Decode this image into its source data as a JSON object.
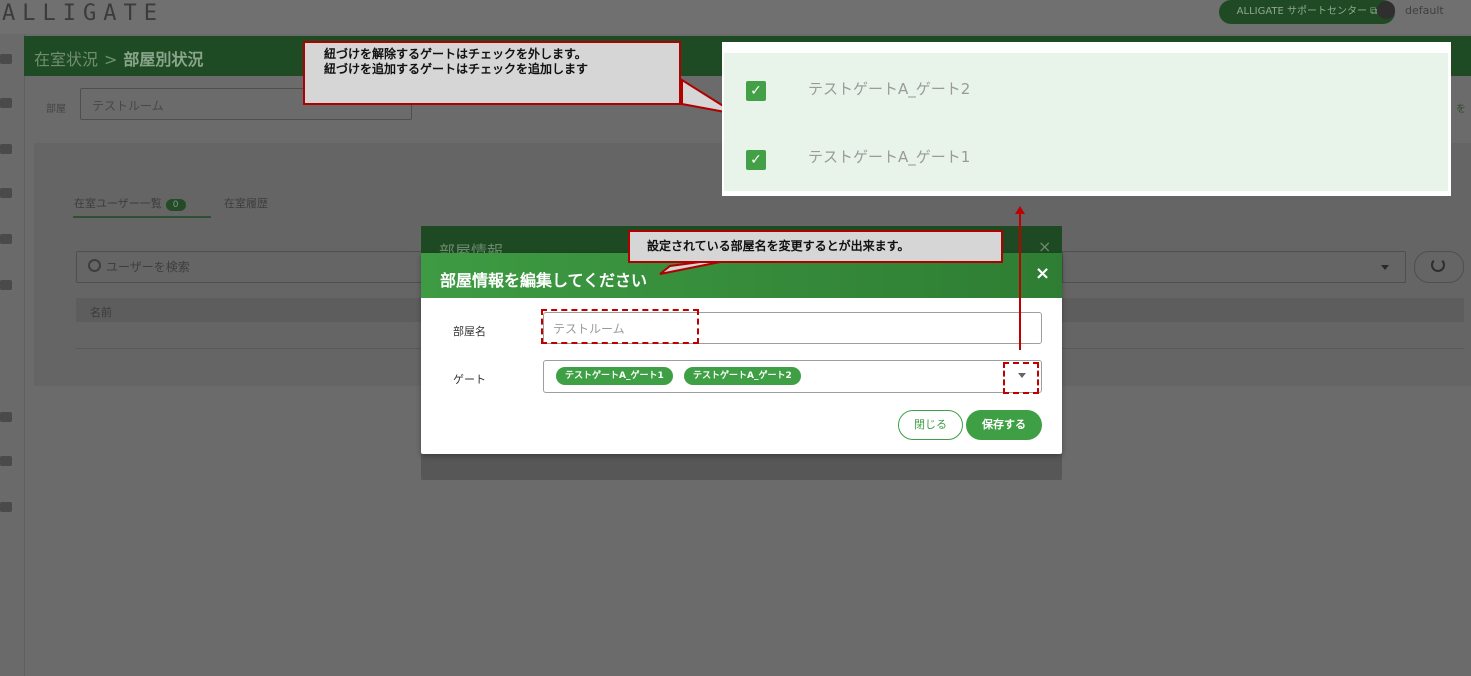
{
  "app": {
    "logo": "ALLIGATE",
    "support_link": "ALLIGATE サポートセンター ⧉",
    "user": "default"
  },
  "breadcrumb": {
    "parent": "在室状況",
    "separator": ">",
    "current": "部屋別状況"
  },
  "room_filter": {
    "label": "部屋",
    "value": "テストルーム"
  },
  "tabs": [
    {
      "label": "在室ユーザー一覧",
      "badge": "0"
    },
    {
      "label": "在室履歴"
    }
  ],
  "search": {
    "placeholder": "ユーザーを検索"
  },
  "table": {
    "header_name": "名前"
  },
  "edge_link": "を",
  "bg_modal": {
    "title": "部屋情報",
    "close": "×"
  },
  "modal": {
    "title": "部屋情報を編集してください",
    "close": "×",
    "name_label": "部屋名",
    "name_placeholder": "テストルーム",
    "gate_label": "ゲート",
    "gates": [
      "テストゲートA_ゲート1",
      "テストゲートA_ゲート2"
    ],
    "btn_close": "閉じる",
    "btn_save": "保存する"
  },
  "callouts": {
    "top_line1": "紐づけを解除するゲートはチェックを外します。",
    "top_line2": "紐づけを追加するゲートはチェックを追加します",
    "mid": "設定されている部屋名を変更するとが出来ます。"
  },
  "gate_popup": {
    "items": [
      {
        "label": "テストゲートA_ゲート2",
        "checked": true
      },
      {
        "label": "テストゲートA_ゲート1",
        "checked": true
      }
    ]
  },
  "colors": {
    "accent": "#3f9f45",
    "annotation": "#c00000"
  }
}
